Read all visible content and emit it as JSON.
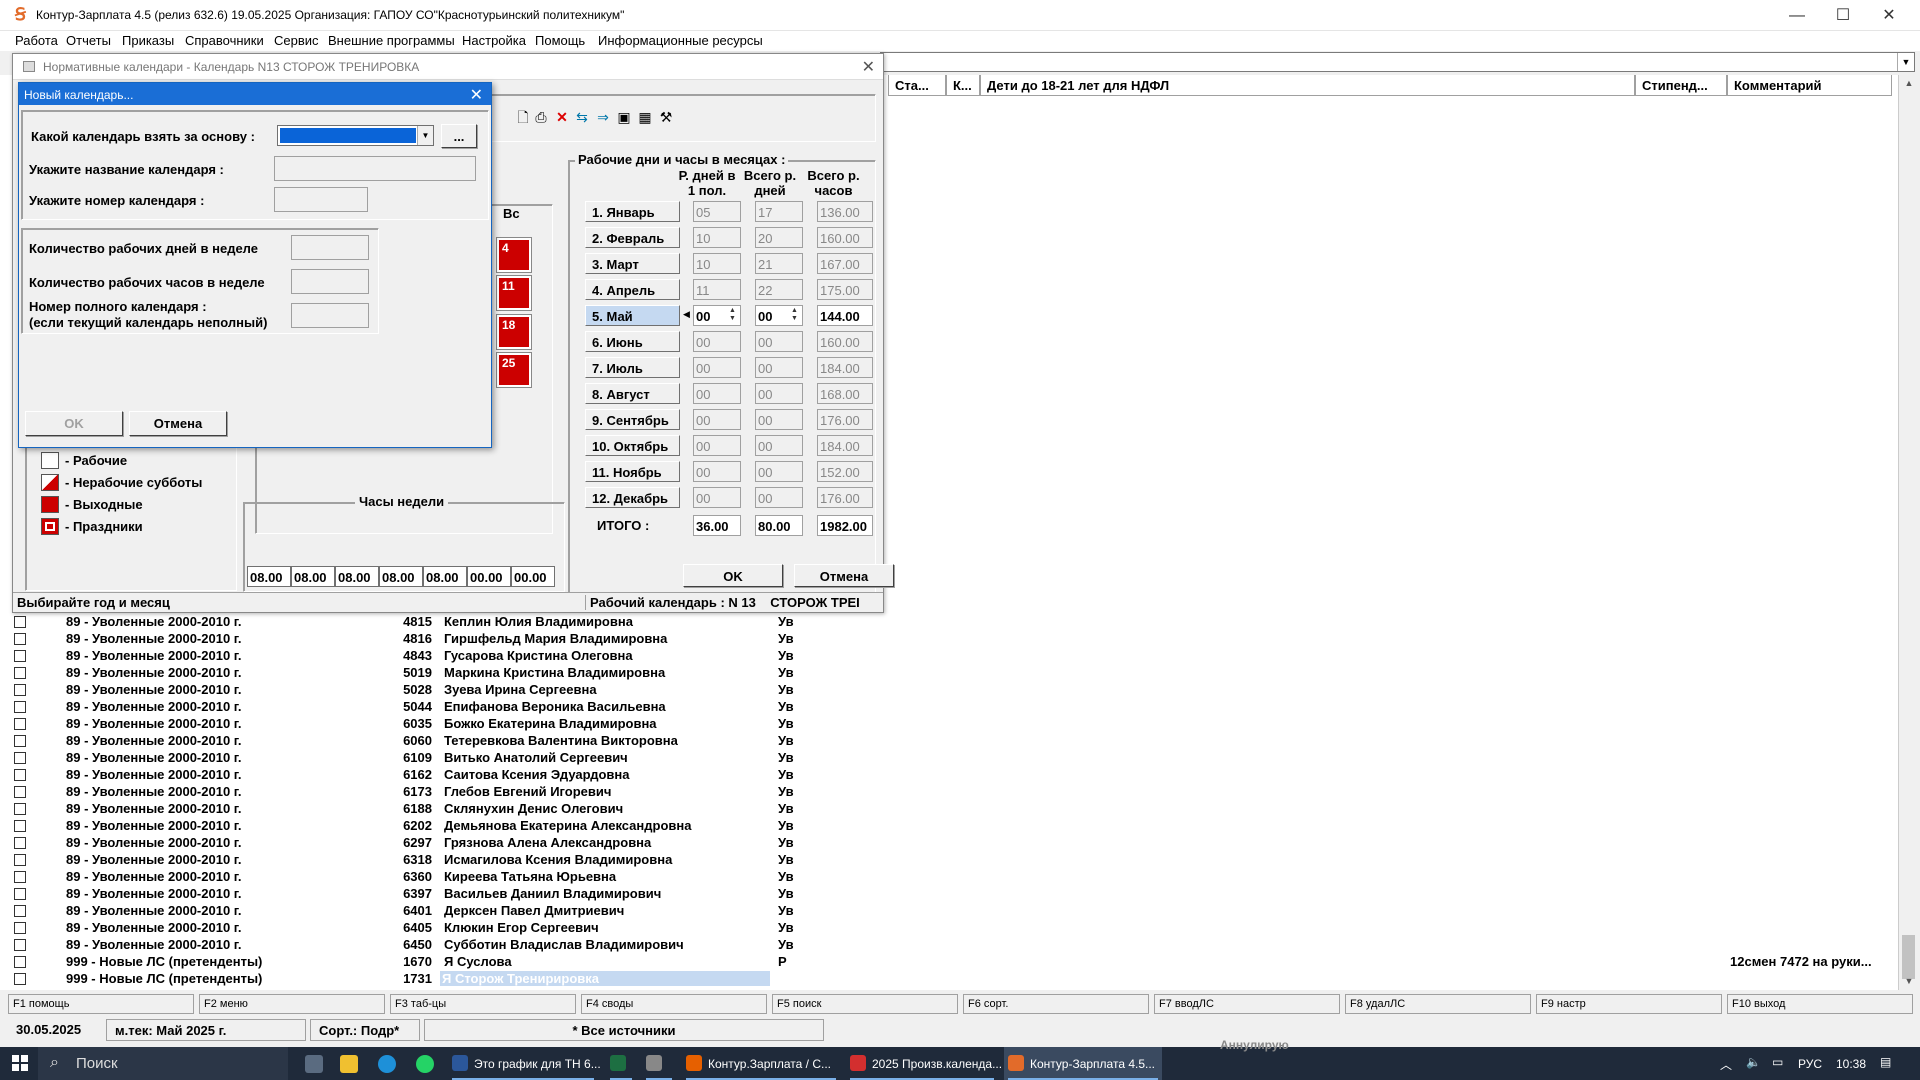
{
  "window": {
    "title": "Контур-Зарплата 4.5 (релиз 632.6) 19.05.2025  Организация: ГАПОУ СО\"Краснотурьинский политехникум\"",
    "minimize": "—",
    "maximize": "☐",
    "close": "✕"
  },
  "menu": [
    "Работа",
    "Отчеты",
    "Приказы",
    "Справочники",
    "Сервис",
    "Внешние программы",
    "Настройка",
    "Помощь",
    "Информационные ресурсы"
  ],
  "grid": {
    "headers": {
      "sta": "Ста...",
      "k": "К...",
      "children": "Дети до 18-21 лет для НДФЛ",
      "stipend": "Стипенд...",
      "comment": "Комментарий"
    },
    "rows": [
      {
        "group": "89 - Уволенные 2000-2010 г.",
        "num": "4815",
        "name": "Кеплин Юлия Владимировна",
        "status": "Ув",
        "comment": ""
      },
      {
        "group": "89 - Уволенные 2000-2010 г.",
        "num": "4816",
        "name": "Гиршфельд Мария Владимировна",
        "status": "Ув",
        "comment": ""
      },
      {
        "group": "89 - Уволенные 2000-2010 г.",
        "num": "4843",
        "name": "Гусарова Кристина Олеговна",
        "status": "Ув",
        "comment": ""
      },
      {
        "group": "89 - Уволенные 2000-2010 г.",
        "num": "5019",
        "name": "Маркина Кристина Владимировна",
        "status": "Ув",
        "comment": ""
      },
      {
        "group": "89 - Уволенные 2000-2010 г.",
        "num": "5028",
        "name": "Зуева Ирина Сергеевна",
        "status": "Ув",
        "comment": ""
      },
      {
        "group": "89 - Уволенные 2000-2010 г.",
        "num": "5044",
        "name": "Епифанова Вероника Васильевна",
        "status": "Ув",
        "comment": ""
      },
      {
        "group": "89 - Уволенные 2000-2010 г.",
        "num": "6035",
        "name": "Божко Екатерина Владимировна",
        "status": "Ув",
        "comment": ""
      },
      {
        "group": "89 - Уволенные 2000-2010 г.",
        "num": "6060",
        "name": "Тетеревкова Валентина Викторовна",
        "status": "Ув",
        "comment": ""
      },
      {
        "group": "89 - Уволенные 2000-2010 г.",
        "num": "6109",
        "name": "Витько Анатолий Сергеевич",
        "status": "Ув",
        "comment": ""
      },
      {
        "group": "89 - Уволенные 2000-2010 г.",
        "num": "6162",
        "name": "Саитова Ксения Эдуардовна",
        "status": "Ув",
        "comment": ""
      },
      {
        "group": "89 - Уволенные 2000-2010 г.",
        "num": "6173",
        "name": "Глебов Евгений Игоревич",
        "status": "Ув",
        "comment": ""
      },
      {
        "group": "89 - Уволенные 2000-2010 г.",
        "num": "6188",
        "name": "Склянухин Денис Олегович",
        "status": "Ув",
        "comment": ""
      },
      {
        "group": "89 - Уволенные 2000-2010 г.",
        "num": "6202",
        "name": "Демьянова Екатерина Александровна",
        "status": "Ув",
        "comment": ""
      },
      {
        "group": "89 - Уволенные 2000-2010 г.",
        "num": "6297",
        "name": "Грязнова Алена Александровна",
        "status": "Ув",
        "comment": ""
      },
      {
        "group": "89 - Уволенные 2000-2010 г.",
        "num": "6318",
        "name": "Исмагилова Ксения Владимировна",
        "status": "Ув",
        "comment": ""
      },
      {
        "group": "89 - Уволенные 2000-2010 г.",
        "num": "6360",
        "name": "Киреева Татьяна Юрьевна",
        "status": "Ув",
        "comment": ""
      },
      {
        "group": "89 - Уволенные 2000-2010 г.",
        "num": "6397",
        "name": "Васильев Даниил Владимирович",
        "status": "Ув",
        "comment": ""
      },
      {
        "group": "89 - Уволенные 2000-2010 г.",
        "num": "6401",
        "name": "Дерксен Павел Дмитриевич",
        "status": "Ув",
        "comment": ""
      },
      {
        "group": "89 - Уволенные 2000-2010 г.",
        "num": "6405",
        "name": "Клюкин Егор Сергеевич",
        "status": "Ув",
        "comment": ""
      },
      {
        "group": "89 - Уволенные 2000-2010 г.",
        "num": "6450",
        "name": "Субботин Владислав Владимирович",
        "status": "Ув",
        "comment": ""
      },
      {
        "group": "999 - Новые ЛС (претенденты)",
        "num": "1670",
        "name": "Я Суслова",
        "status": "Р",
        "comment": "12смен 7472 на руки..."
      },
      {
        "group": "999 - Новые ЛС (претенденты)",
        "num": "1731",
        "name": "Я Сторож Тренирировка",
        "status": "",
        "comment": ""
      }
    ]
  },
  "fkeys": [
    {
      "key": "F1",
      "label": "помощь"
    },
    {
      "key": "F2",
      "label": "меню"
    },
    {
      "key": "F3",
      "label": "таб-цы"
    },
    {
      "key": "F4",
      "label": "своды"
    },
    {
      "key": "F5",
      "label": "поиск"
    },
    {
      "key": "F6",
      "label": "сорт."
    },
    {
      "key": "F7",
      "label": "вводЛС"
    },
    {
      "key": "F8",
      "label": "удалЛС"
    },
    {
      "key": "F9",
      "label": "настр"
    },
    {
      "key": "F10",
      "label": "выход"
    }
  ],
  "statusbar": {
    "date": "30.05.2025",
    "month": "м.тек: Май 2025 г.",
    "sort": "Сорт.: Подр*",
    "sources": "* Все источники"
  },
  "taskbar": {
    "search": "Поиск",
    "apps": [
      {
        "label": "Это график для ТН 6...",
        "color": "#2b579a"
      },
      {
        "label": "",
        "color": "#1d6f42"
      },
      {
        "label": "",
        "color": "#888"
      },
      {
        "label": "Контур.Зарплата / С...",
        "color": "#e66000"
      },
      {
        "label": "2025 Произв.календа...",
        "color": "#d32f2f"
      },
      {
        "label": "Контур-Зарплата 4.5...",
        "color": "#e26b2a"
      }
    ],
    "lang": "РУС",
    "time": "10:38",
    "bg_text": "Аннулирую"
  },
  "calendar_dialog": {
    "title": "Нормативные календари - Календарь N13 СТОРОЖ ТРЕНИРОВКА",
    "months_title": "Рабочие дни и часы в месяцах :",
    "col_headers": {
      "days_half": "Р. дней в 1 пол.",
      "total_days": "Всего р. дней",
      "total_hours": "Всего р. часов"
    },
    "months": [
      {
        "name": "1. Январь",
        "d1": "05",
        "d": "17",
        "h": "136.00"
      },
      {
        "name": "2. Февраль",
        "d1": "10",
        "d": "20",
        "h": "160.00"
      },
      {
        "name": "3. Март",
        "d1": "10",
        "d": "21",
        "h": "167.00"
      },
      {
        "name": "4. Апрель",
        "d1": "11",
        "d": "22",
        "h": "175.00"
      },
      {
        "name": "5. Май",
        "d1": "00",
        "d": "00",
        "h": "144.00"
      },
      {
        "name": "6. Июнь",
        "d1": "00",
        "d": "00",
        "h": "160.00"
      },
      {
        "name": "7. Июль",
        "d1": "00",
        "d": "00",
        "h": "184.00"
      },
      {
        "name": "8. Август",
        "d1": "00",
        "d": "00",
        "h": "168.00"
      },
      {
        "name": "9. Сентябрь",
        "d1": "00",
        "d": "00",
        "h": "176.00"
      },
      {
        "name": "10. Октябрь",
        "d1": "00",
        "d": "00",
        "h": "184.00"
      },
      {
        "name": "11. Ноябрь",
        "d1": "00",
        "d": "00",
        "h": "152.00"
      },
      {
        "name": "12. Декабрь",
        "d1": "00",
        "d": "00",
        "h": "176.00"
      }
    ],
    "total": {
      "label": "ИТОГО :",
      "d1": "36.00",
      "d": "80.00",
      "h": "1982.00"
    },
    "weekday_label": "Вс",
    "sunday_days": [
      "4",
      "11",
      "18",
      "25"
    ],
    "legend": [
      {
        "label": "- Рабочие",
        "type": "work"
      },
      {
        "label": "- Нерабочие субботы",
        "type": "sat"
      },
      {
        "label": "- Выходные",
        "type": "off"
      },
      {
        "label": "- Праздники",
        "type": "hol"
      }
    ],
    "week_hours_title": "Часы недели",
    "week_hours": [
      "08.00",
      "08.00",
      "08.00",
      "08.00",
      "08.00",
      "00.00",
      "00.00"
    ],
    "ok": "OK",
    "cancel": "Отмена",
    "status_left": "Выбирайте год и месяц",
    "status_right": "Рабочий календарь : N 13    СТОРОЖ ТРЕI",
    "colors": {
      "red": "#cc0000",
      "active_month": "#c5d9f1"
    }
  },
  "new_calendar_dialog": {
    "title": "Новый календарь...",
    "base_label": "Какой календарь взять за основу :",
    "base_value": "",
    "browse": "...",
    "name_label": "Укажите название календаря :",
    "number_label": "Укажите номер календаря :",
    "work_days_label": "Количество рабочих дней в неделе",
    "work_hours_label": "Количество рабочих часов в неделе",
    "full_cal_label1": "Номер полного календаря :",
    "full_cal_label2": "(если текущий календарь неполный)",
    "ok": "OK",
    "cancel": "Отмена"
  }
}
